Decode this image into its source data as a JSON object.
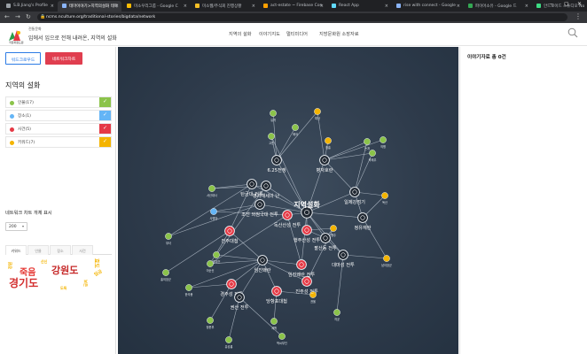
{
  "browser": {
    "tabs": [
      {
        "title": "S.B.Jiang's Profile",
        "color": "#9aa0a6"
      },
      {
        "title": "테마이야기>지역의설화 테마",
        "color": "#8ab4f8",
        "active": true
      },
      {
        "title": "미소우리그룹 - Google C",
        "color": "#fbbc04"
      },
      {
        "title": "미소웹/주식회 진행상황",
        "color": "#f6bf26"
      },
      {
        "title": "act-estate ~ Firebase Con",
        "color": "#ffa000"
      },
      {
        "title": "React App",
        "color": "#61dafb"
      },
      {
        "title": "rise with connect - Google",
        "color": "#8ab4f8"
      },
      {
        "title": "파이어소유 - Google 드",
        "color": "#34a853"
      },
      {
        "title": "안드로이드 스튜디오 No",
        "color": "#3ddc84"
      }
    ],
    "url": "ncms.nculture.org/traditional-stories/bigdata/network"
  },
  "site": {
    "brand_small": "전통문화",
    "brand_title": "입에서 입으로 전해 내려온, 지역의 설화",
    "logo_caption": "국문화원도원",
    "nav": [
      "지역의 설화",
      "이야기지도",
      "멀티미디어",
      "지방문화원 소장자료"
    ]
  },
  "sidebar": {
    "btn_cloud": "워드크로우드",
    "btn_network": "네트워크차트",
    "section_title": "지역의 설화",
    "categories": [
      {
        "label": "인물(17)",
        "color": "#8bc34a"
      },
      {
        "label": "장소(1)",
        "color": "#64b5f6"
      },
      {
        "label": "사건(5)",
        "color": "#e53945"
      },
      {
        "label": "키워드(7)",
        "color": "#f4b400"
      }
    ],
    "network_count_label": "네트워크 차트 개체 표시",
    "count_value": "200",
    "cloud_tabs": [
      "키워드",
      "인물",
      "장소",
      "사건"
    ],
    "words": [
      {
        "text": "죽음",
        "color": "#e53935"
      },
      {
        "text": "강원도",
        "color": "#c62828"
      },
      {
        "text": "경기도",
        "color": "#d32f2f"
      },
      {
        "text": "강원",
        "color": "#f4b400"
      },
      {
        "text": "산신",
        "color": "#f4b400"
      },
      {
        "text": "효도",
        "color": "#f4b400"
      },
      {
        "text": "임금",
        "color": "#f4b400"
      },
      {
        "text": "보은",
        "color": "#f4b400"
      },
      {
        "text": "도둑",
        "color": "#f4b400"
      }
    ]
  },
  "graph": {
    "hubs": [
      "6.25전쟁",
      "병자호란",
      "임진왜란",
      "지역설화",
      "일제강점기",
      "병자재세의 난",
      "정유재란",
      "조선 외침국대 전투",
      "독산산성 전투",
      "행주산성 전투",
      "임진왜란 전투",
      "경주성 전투",
      "진주대첩",
      "권산 전투",
      "당항포대첩",
      "진주성 전투",
      "대마성 전투",
      "팔산동 전투",
      "탄금대 전투"
    ],
    "leaves": [
      "유격",
      "피난",
      "장흥",
      "고인",
      "애국",
      "논개",
      "의병",
      "곽재우",
      "독산",
      "행주",
      "이순신",
      "사명당",
      "부녀",
      "김대건",
      "서산대사",
      "한석봉",
      "유성룡",
      "박씨부인",
      "권율",
      "정문부",
      "남이장군",
      "허균",
      "계백",
      "홍의장군"
    ]
  },
  "rightpanel": {
    "title": "이야기자료 총 0건"
  }
}
